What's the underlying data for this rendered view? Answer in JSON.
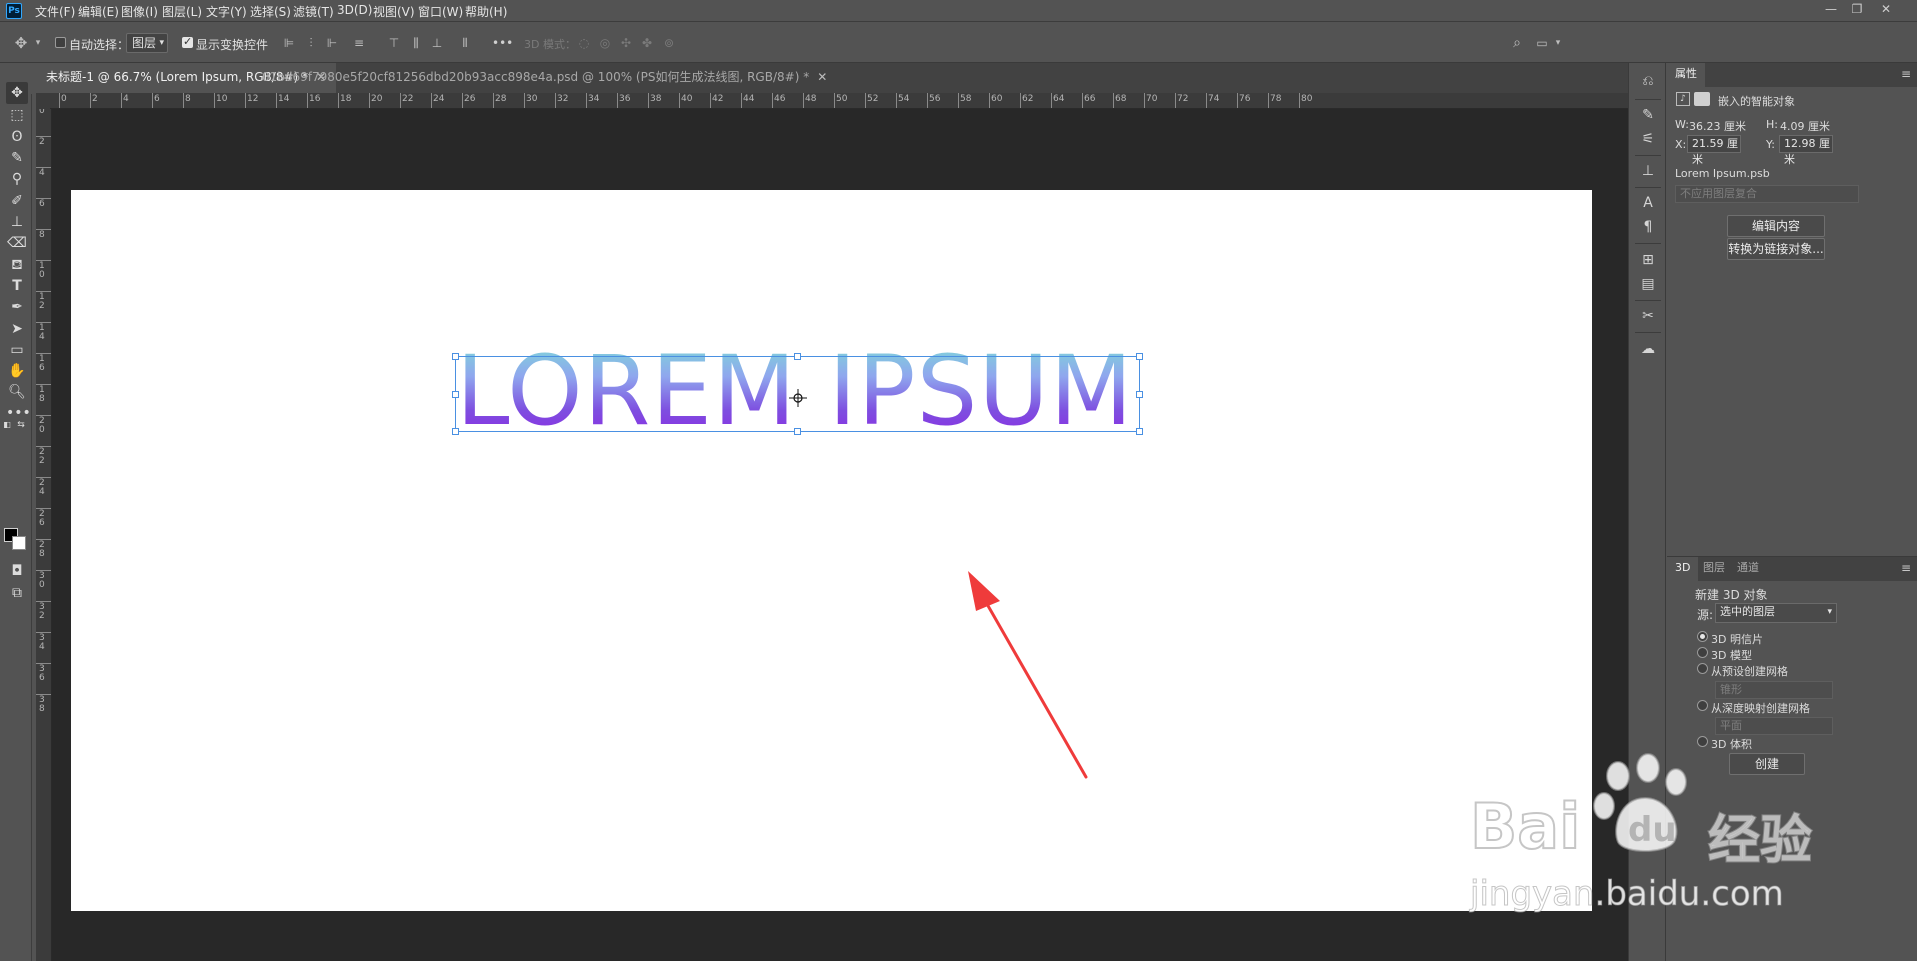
{
  "menubar": {
    "logo": "Ps",
    "items": [
      "文件(F)",
      "编辑(E)",
      "图像(I)",
      "图层(L)",
      "文字(Y)",
      "选择(S)",
      "滤镜(T)",
      "3D(D)",
      "视图(V)",
      "窗口(W)",
      "帮助(H)"
    ],
    "window_controls": [
      "minimize",
      "restore",
      "close"
    ]
  },
  "options": {
    "auto_select_label": "自动选择：",
    "auto_select_checked": false,
    "auto_select_target": "图层",
    "show_transform_label": "显示变换控件",
    "show_transform_checked": true,
    "more_label": "•••",
    "mode_3d_label": "3D 模式："
  },
  "tabs": [
    {
      "label": "未标题-1 @ 66.7% (Lorem Ipsum, RGB/8#) *",
      "active": true
    },
    {
      "label": "01bd69f7980e5f20cf81256dbd20b93acc898e4a.psd @ 100% (PS如何生成法线图, RGB/8#) *",
      "active": false
    }
  ],
  "ruler_h_labels": [
    "0",
    "2",
    "4",
    "6",
    "8",
    "10",
    "12",
    "14",
    "16",
    "18",
    "20",
    "22",
    "24",
    "26",
    "28",
    "30",
    "32",
    "34",
    "36",
    "38",
    "40",
    "42",
    "44",
    "46",
    "48",
    "50",
    "52",
    "54",
    "56",
    "58",
    "60",
    "62",
    "64",
    "66",
    "68",
    "70",
    "72",
    "74",
    "76",
    "78",
    "80"
  ],
  "ruler_v_labels": [
    "0",
    "2",
    "4",
    "6",
    "8",
    "10",
    "12",
    "14",
    "16",
    "18",
    "20",
    "22",
    "24",
    "26",
    "28",
    "30",
    "32",
    "34",
    "36",
    "38"
  ],
  "canvas": {
    "text": "LOREM IPSUM",
    "gradient_colors": [
      "#7ed7d8",
      "#8fa6ee",
      "#7e4fe0",
      "#8a2be2"
    ],
    "annotation_arrow_color": "#ef3b3b"
  },
  "properties": {
    "tab": "属性",
    "object_type": "嵌入的智能对象",
    "w_label": "W:",
    "w_value": "36.23 厘米",
    "h_label": "H:",
    "h_value": "4.09 厘米",
    "x_label": "X:",
    "x_value": "21.59 厘米",
    "y_label": "Y:",
    "y_value": "12.98 厘米",
    "filename": "Lorem Ipsum.psb",
    "layer_comp_placeholder": "不应用图层复合",
    "edit_contents": "编辑内容",
    "convert_linked": "转换为链接对象..."
  },
  "panel_3d": {
    "tabs": [
      "3D",
      "图层",
      "通道"
    ],
    "group_title": "新建 3D 对象",
    "source_label": "源:",
    "source_value": "选中的图层",
    "options": [
      "3D 明信片",
      "3D 模型",
      "从预设创建网格",
      "从深度映射创建网格",
      "3D 体积"
    ],
    "selected_option": 0,
    "preset_mesh_value": "锥形",
    "depth_map_value": "平面",
    "create_button": "创建"
  },
  "watermark": {
    "brand": "Bai",
    "brand_suffix": "du",
    "product": "经验",
    "url": "jingyan.baidu.com"
  }
}
